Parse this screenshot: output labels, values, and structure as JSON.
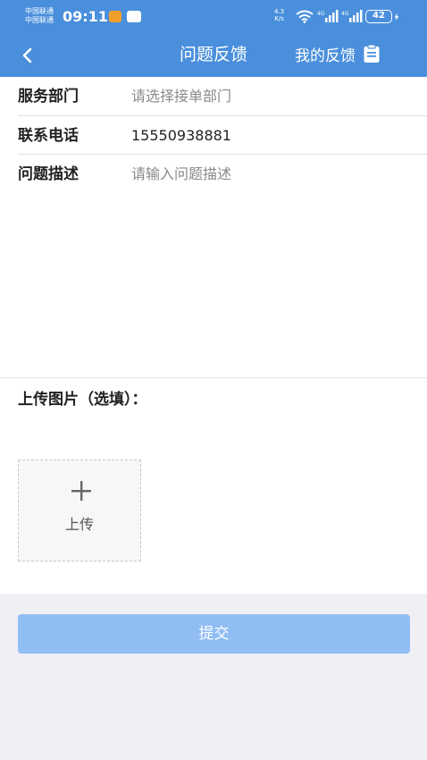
{
  "status_bar": {
    "carrier_line1": "中国联通",
    "carrier_line2": "中国联通",
    "time": "09:11",
    "net_speed_value": "4.3",
    "net_speed_unit": "K/s",
    "signal1_label": "4G",
    "signal2_label": "4G",
    "battery": "42"
  },
  "nav": {
    "title": "问题反馈",
    "right_label": "我的反馈"
  },
  "form": {
    "department": {
      "label": "服务部门",
      "placeholder": "请选择接单部门"
    },
    "phone": {
      "label": "联系电话",
      "value": "15550938881"
    },
    "description": {
      "label": "问题描述",
      "placeholder": "请输入问题描述"
    }
  },
  "upload": {
    "label": "上传图片（选填）：",
    "button_label": "上传"
  },
  "submit_label": "提交",
  "colors": {
    "header": "#4a8fdc",
    "submit": "#90bdf3",
    "background": "#efeff4"
  }
}
